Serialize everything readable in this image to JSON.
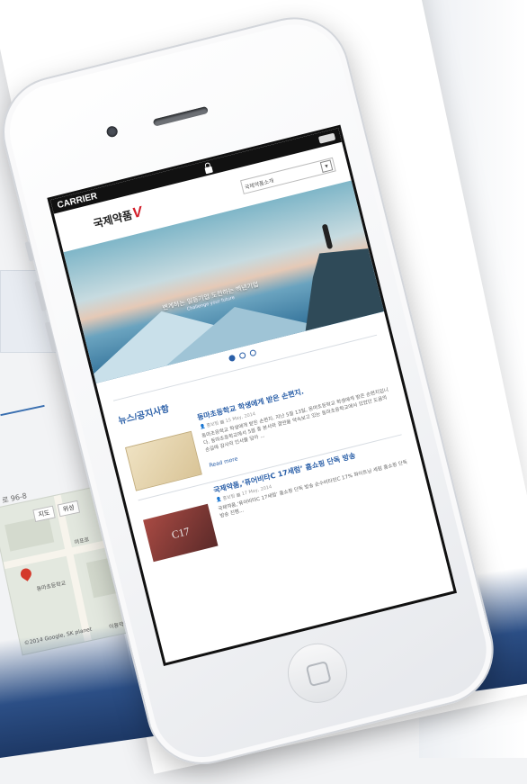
{
  "background": {
    "address": "로 96-8",
    "map": {
      "ctrl_map": "지도",
      "ctrl_sat": "위성",
      "label_1": "마포로",
      "label_2": "동마초등학교",
      "copyright": "©2014 Google, SK planet",
      "footer": "이용약관"
    }
  },
  "phone": {
    "status": {
      "carrier": "CARRIER"
    },
    "site": {
      "logo_text": "국제약품",
      "logo_mark": "V",
      "select_value": "국제약품소개"
    },
    "hero": {
      "caption": "변계하는 일등기업 도전하는 백년기업",
      "sub": "Challenge your future"
    },
    "news": {
      "section_title": "뉴스/공지사항",
      "items": [
        {
          "headline": "동마초등학교 학생에게 받은 손편지.",
          "author": "홍보팀",
          "date": "15 May, 2014",
          "text": "동마초등학교 학생에게 받은 손편지. 지난 5월 13일, 동마초등학교 학생에게 받은 손편지입니다. 동마초등학교에서 5월 중 본사와 결연을 약속보고 있는 동마초등학교에서 있었던 도움의 손길에 감사의 인사를 담아 ...",
          "read_more": "Read more"
        },
        {
          "headline": "국제약품,‘퓨어비타C 17세럼’ 홈쇼핑 단독 방송",
          "author": "홍보팀",
          "date": "17 May, 2014",
          "text": "국제약품,‘퓨어비타C 17세럼’ 홈쇼핑 단독 방송 순수비타민C 17% 화이트닝 세럼 홈쇼핑 단독 방송 진행..."
        }
      ],
      "thumb_label": "C17"
    }
  }
}
